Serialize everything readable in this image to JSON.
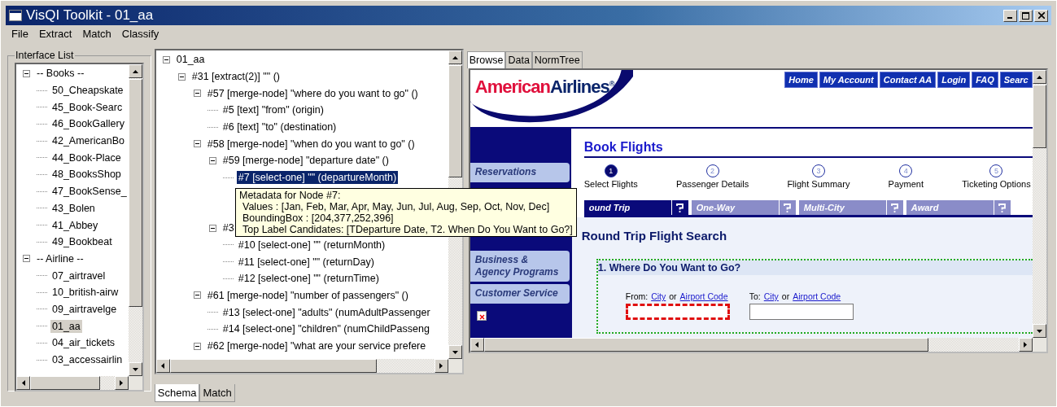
{
  "window": {
    "title": "VisQI Toolkit - 01_aa"
  },
  "menu": [
    "File",
    "Extract",
    "Match",
    "Classify"
  ],
  "interface_list": {
    "title": "Interface List",
    "items": [
      {
        "label": "-- Books --",
        "expanded": true,
        "selected": false,
        "children": [
          {
            "label": "50_Cheapskate",
            "selected": false
          },
          {
            "label": "45_Book-Searc",
            "selected": false
          },
          {
            "label": "46_BookGallery",
            "selected": false
          },
          {
            "label": "42_AmericanBo",
            "selected": false
          },
          {
            "label": "44_Book-Place",
            "selected": false
          },
          {
            "label": "48_BooksShop",
            "selected": false
          },
          {
            "label": "47_BookSense_",
            "selected": false
          },
          {
            "label": "43_Bolen",
            "selected": false
          },
          {
            "label": "41_Abbey",
            "selected": false
          },
          {
            "label": "49_Bookbeat",
            "selected": false
          }
        ]
      },
      {
        "label": "-- Airline --",
        "expanded": true,
        "selected": false,
        "children": [
          {
            "label": "07_airtravel",
            "selected": false
          },
          {
            "label": "10_british-airw",
            "selected": false
          },
          {
            "label": "09_airtravelge",
            "selected": false
          },
          {
            "label": "01_aa",
            "selected": true
          },
          {
            "label": "04_air_tickets",
            "selected": false
          },
          {
            "label": "03_accessairlin",
            "selected": false
          }
        ]
      }
    ]
  },
  "schema_tree": {
    "items": [
      {
        "label": "01_aa",
        "expanded": true,
        "selected": false,
        "children": [
          {
            "label": "#31 [extract(2)]  \"\" ()",
            "expanded": true,
            "selected": false,
            "children": [
              {
                "label": "#57 [merge-node]  \"where do you want to go\" ()",
                "expanded": true,
                "selected": false,
                "children": [
                  {
                    "label": "#5 [text]  \"from\" (origin)",
                    "selected": false
                  },
                  {
                    "label": "#6 [text]  \"to\" (destination)",
                    "selected": false
                  }
                ]
              },
              {
                "label": "#58 [merge-node]  \"when do you want to go\" ()",
                "expanded": true,
                "selected": false,
                "children": [
                  {
                    "label": "#59 [merge-node]  \"departure date\" ()",
                    "expanded": true,
                    "selected": false,
                    "children": [
                      {
                        "label": "#7 [select-one]  \"\" (departureMonth)",
                        "selected": true
                      },
                      {
                        "kind": "covered"
                      },
                      {
                        "kind": "covered"
                      }
                    ]
                  },
                  {
                    "label": "#3",
                    "expanded": true,
                    "selected": false,
                    "children": [
                      {
                        "label": "#10 [select-one]  \"\" (returnMonth)",
                        "selected": false
                      },
                      {
                        "label": "#11 [select-one]  \"\" (returnDay)",
                        "selected": false
                      },
                      {
                        "label": "#12 [select-one]  \"\" (returnTime)",
                        "selected": false
                      }
                    ]
                  }
                ]
              },
              {
                "label": "#61 [merge-node]  \"number of passengers\" ()",
                "expanded": true,
                "selected": false,
                "children": [
                  {
                    "label": "#13 [select-one]  \"adults\" (numAdultPassenger",
                    "selected": false
                  },
                  {
                    "label": "#14 [select-one]  \"children\" (numChildPasseng",
                    "selected": false
                  }
                ]
              },
              {
                "label": "#62 [merge-node]  \"what are your service prefere",
                "expanded": true,
                "selected": false
              }
            ]
          }
        ]
      }
    ]
  },
  "bottom_tabs": [
    {
      "label": "Schema",
      "selected": true
    },
    {
      "label": "Match",
      "selected": false
    }
  ],
  "browser_tabs": [
    {
      "label": "Browse",
      "selected": true
    },
    {
      "label": "Data",
      "selected": false
    },
    {
      "label": "NormTree",
      "selected": false
    }
  ],
  "web_page": {
    "logo": {
      "first": "American",
      "second": "Airlines",
      "mark": "®"
    },
    "nav": [
      "Home",
      "My Account",
      "Contact AA",
      "Login",
      "FAQ",
      "Searc"
    ],
    "sidebar": [
      {
        "kind": "link",
        "label": "Reservations"
      },
      {
        "kind": "covered"
      },
      {
        "kind": "covered"
      },
      {
        "kind": "covered"
      },
      {
        "kind": "link",
        "label": "Business & Agency Programs"
      },
      {
        "kind": "link",
        "label": "Customer Service"
      },
      {
        "kind": "image"
      }
    ],
    "title": "Book Flights",
    "steps": [
      {
        "number": "1",
        "label": "Select Flights",
        "selected": true
      },
      {
        "number": "2",
        "label": "Passenger Details",
        "selected": false
      },
      {
        "number": "3",
        "label": "Flight Summary",
        "selected": false
      },
      {
        "number": "4",
        "label": "Payment",
        "selected": false
      },
      {
        "number": "5",
        "label": "Ticketing Options",
        "selected": false
      }
    ],
    "search_tabs": [
      {
        "label": "ound Trip",
        "selected": true
      },
      {
        "label": "One-Way",
        "selected": false
      },
      {
        "label": "Multi-City",
        "selected": false
      },
      {
        "label": "Award",
        "selected": false
      }
    ],
    "search_title": "Round Trip Flight Search",
    "section": "1. Where Do You Want to Go?",
    "fields": [
      {
        "label": "From:",
        "link_1": "City",
        "or": "or",
        "link_2": "Airport Code",
        "highlighted": true
      },
      {
        "label": "To:",
        "link_1": "City",
        "or": "or",
        "link_2": "Airport Code",
        "highlighted": false
      }
    ]
  },
  "tooltip": {
    "title": "Metadata for Node  #7:",
    "lines": [
      "Values : [Jan, Feb, Mar, Apr, May, Jun, Jul, Aug, Sep, Oct, Nov, Dec]",
      "BoundingBox : [204,377,252,396]",
      "Top Label Candidates: [TDeparture Date, T2. When Do You Want to Go?]"
    ]
  }
}
